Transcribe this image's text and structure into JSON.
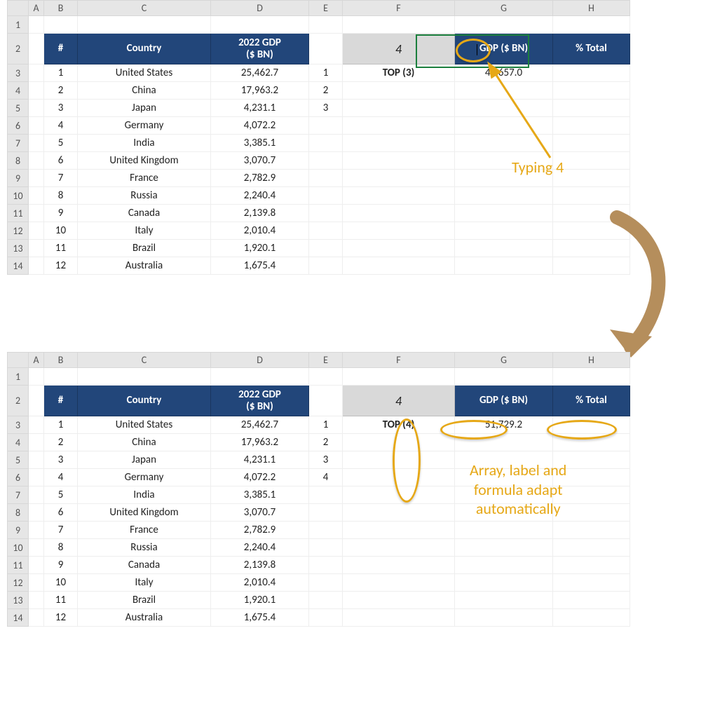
{
  "columns": [
    "",
    "A",
    "B",
    "C",
    "D",
    "E",
    "F",
    "G",
    "H"
  ],
  "rows": [
    1,
    2,
    3,
    4,
    5,
    6,
    7,
    8,
    9,
    10,
    11,
    12,
    13,
    14
  ],
  "headers": {
    "num": "#",
    "country": "Country",
    "gdp2022": "2022 GDP\n($ BN)",
    "gdp": "GDP ($ BN)",
    "pct": "% Total"
  },
  "data": [
    {
      "n": 1,
      "country": "United States",
      "gdp": "25,462.7"
    },
    {
      "n": 2,
      "country": "China",
      "gdp": "17,963.2"
    },
    {
      "n": 3,
      "country": "Japan",
      "gdp": "4,231.1"
    },
    {
      "n": 4,
      "country": "Germany",
      "gdp": "4,072.2"
    },
    {
      "n": 5,
      "country": "India",
      "gdp": "3,385.1"
    },
    {
      "n": 6,
      "country": "United Kingdom",
      "gdp": "3,070.7"
    },
    {
      "n": 7,
      "country": "France",
      "gdp": "2,782.9"
    },
    {
      "n": 8,
      "country": "Russia",
      "gdp": "2,240.4"
    },
    {
      "n": 9,
      "country": "Canada",
      "gdp": "2,139.8"
    },
    {
      "n": 10,
      "country": "Italy",
      "gdp": "2,010.4"
    },
    {
      "n": 11,
      "country": "Brazil",
      "gdp": "1,920.1"
    },
    {
      "n": 12,
      "country": "Australia",
      "gdp": "1,675.4"
    }
  ],
  "top1": {
    "inputVal": "4",
    "eNums": [
      "1",
      "2",
      "3"
    ],
    "topLabel": "TOP (3)",
    "gdpSum": "47,657.0"
  },
  "top2": {
    "inputVal": "4",
    "eNums": [
      "1",
      "2",
      "3",
      "4"
    ],
    "topLabel": "TOP (4)",
    "gdpSum": "51,729.2"
  },
  "annotations": {
    "typing": "Typing 4",
    "adapt": "Array, label and\nformula adapt\nautomatically"
  }
}
